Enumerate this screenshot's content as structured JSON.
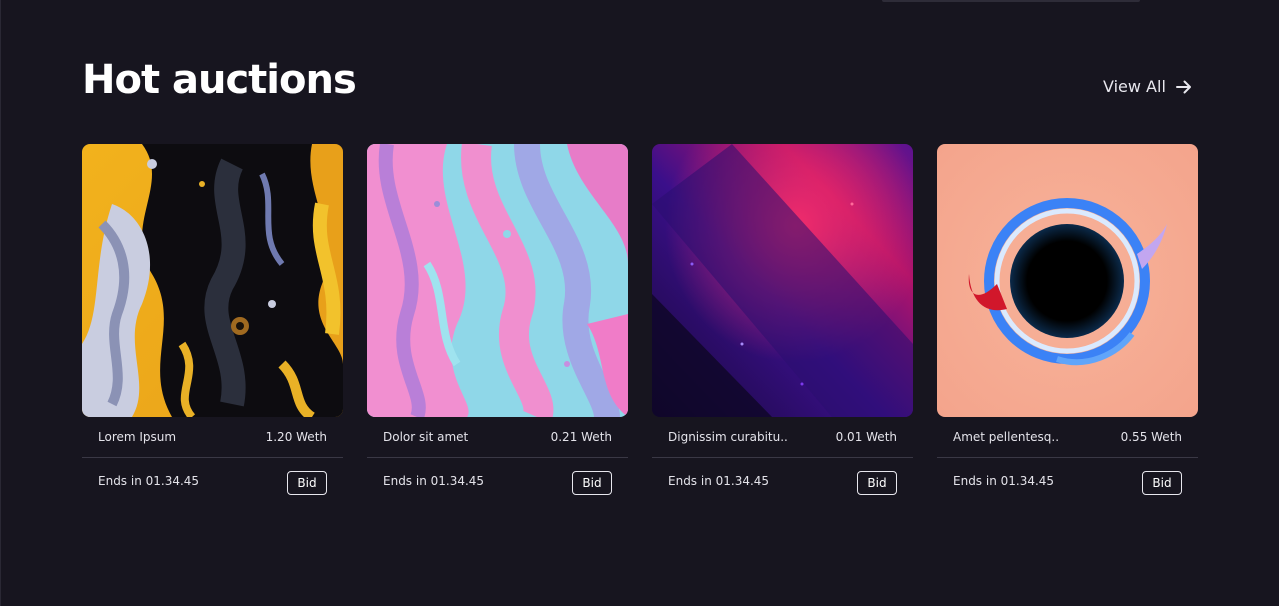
{
  "section": {
    "title": "Hot auctions",
    "view_all_label": "View All"
  },
  "cards": [
    {
      "name": "Lorem Ipsum",
      "price": "1.20 Weth",
      "ends": "Ends in 01.34.45",
      "bid_label": "Bid",
      "art": "abstract-fluid-yellow-black"
    },
    {
      "name": "Dolor sit amet",
      "price": "0.21 Weth",
      "ends": "Ends in 01.34.45",
      "bid_label": "Bid",
      "art": "abstract-fluid-pink-blue"
    },
    {
      "name": "Dignissim curabitu..",
      "price": "0.01 Weth",
      "ends": "Ends in 01.34.45",
      "bid_label": "Bid",
      "art": "abstract-purple-magenta"
    },
    {
      "name": "Amet pellentesq..",
      "price": "0.55 Weth",
      "ends": "Ends in 01.34.45",
      "bid_label": "Bid",
      "art": "abstract-black-hole-peach"
    }
  ],
  "colors": {
    "background": "#17151f",
    "divider": "#3a3845",
    "text": "#ffffff"
  }
}
